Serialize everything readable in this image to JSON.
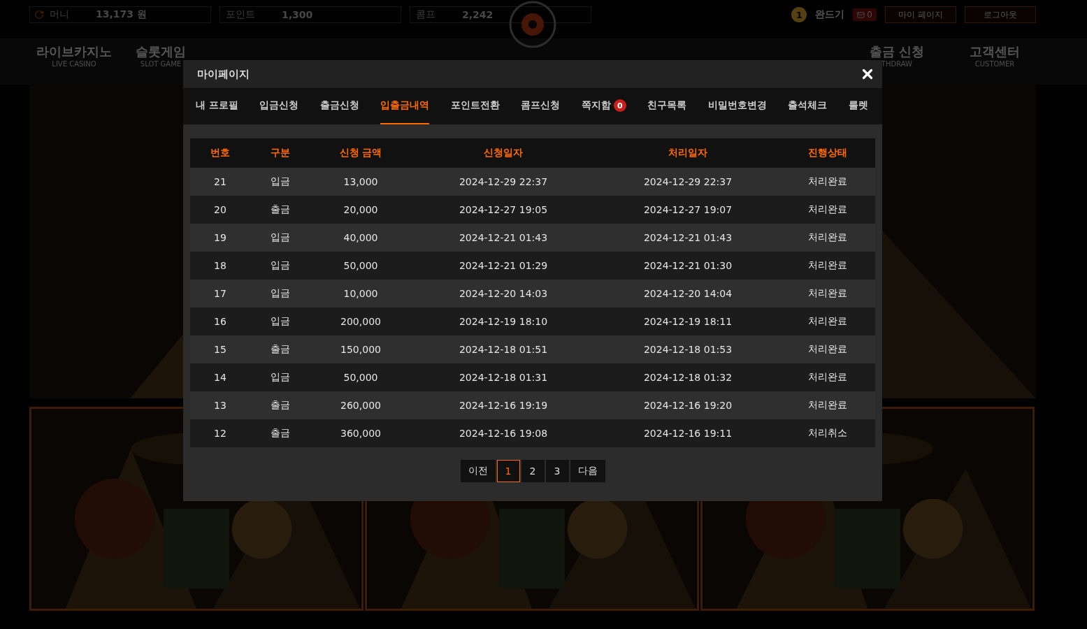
{
  "top_bar": {
    "balances": [
      {
        "label": "머니",
        "value": "13,173 원"
      },
      {
        "label": "포인트",
        "value": "1,300"
      },
      {
        "label": "콤프",
        "value": "2,242"
      }
    ],
    "level": "1",
    "username": "완드기",
    "messages": "0",
    "buttons": [
      "마이 페이지",
      "로그아웃"
    ]
  },
  "nav": {
    "left": [
      {
        "label": "라이브카지노",
        "sub": "LIVE CASINO"
      },
      {
        "label": "슬롯게임",
        "sub": "SLOT GAME"
      }
    ],
    "right": [
      {
        "label": "출금 신청",
        "sub": "THDRAW"
      },
      {
        "label": "고객센터",
        "sub": "CUSTOMER"
      }
    ]
  },
  "modal": {
    "title": "마이페이지",
    "tabs": [
      {
        "label": "내 프로필",
        "selected": false
      },
      {
        "label": "입금신청",
        "selected": false
      },
      {
        "label": "출금신청",
        "selected": false
      },
      {
        "label": "입출금내역",
        "selected": true
      },
      {
        "label": "포인트전환",
        "selected": false
      },
      {
        "label": "콤프신청",
        "selected": false
      },
      {
        "label": "쪽지함",
        "selected": false,
        "badge": "0"
      },
      {
        "label": "친구목록",
        "selected": false
      },
      {
        "label": "비밀번호변경",
        "selected": false
      },
      {
        "label": "출석체크",
        "selected": false
      },
      {
        "label": "룰렛",
        "selected": false
      }
    ],
    "table": {
      "columns": [
        "번호",
        "구분",
        "신청 금액",
        "신청일자",
        "처리일자",
        "진행상태"
      ],
      "rows": [
        [
          "21",
          "입금",
          "13,000",
          "2024-12-29 22:37",
          "2024-12-29 22:37",
          "처리완료"
        ],
        [
          "20",
          "출금",
          "20,000",
          "2024-12-27 19:05",
          "2024-12-27 19:07",
          "처리완료"
        ],
        [
          "19",
          "입금",
          "40,000",
          "2024-12-21 01:43",
          "2024-12-21 01:43",
          "처리완료"
        ],
        [
          "18",
          "입금",
          "50,000",
          "2024-12-21 01:29",
          "2024-12-21 01:30",
          "처리완료"
        ],
        [
          "17",
          "입금",
          "10,000",
          "2024-12-20 14:03",
          "2024-12-20 14:04",
          "처리완료"
        ],
        [
          "16",
          "입금",
          "200,000",
          "2024-12-19 18:10",
          "2024-12-19 18:11",
          "처리완료"
        ],
        [
          "15",
          "출금",
          "150,000",
          "2024-12-18 01:51",
          "2024-12-18 01:53",
          "처리완료"
        ],
        [
          "14",
          "입금",
          "50,000",
          "2024-12-18 01:31",
          "2024-12-18 01:32",
          "처리완료"
        ],
        [
          "13",
          "출금",
          "260,000",
          "2024-12-16 19:19",
          "2024-12-16 19:20",
          "처리완료"
        ],
        [
          "12",
          "출금",
          "360,000",
          "2024-12-16 19:08",
          "2024-12-16 19:11",
          "처리취소"
        ]
      ]
    },
    "pagination": {
      "prev": "이전",
      "pages": [
        {
          "label": "1",
          "selected": true
        },
        {
          "label": "2",
          "selected": false
        },
        {
          "label": "3",
          "selected": false
        }
      ],
      "next": "다음"
    }
  }
}
